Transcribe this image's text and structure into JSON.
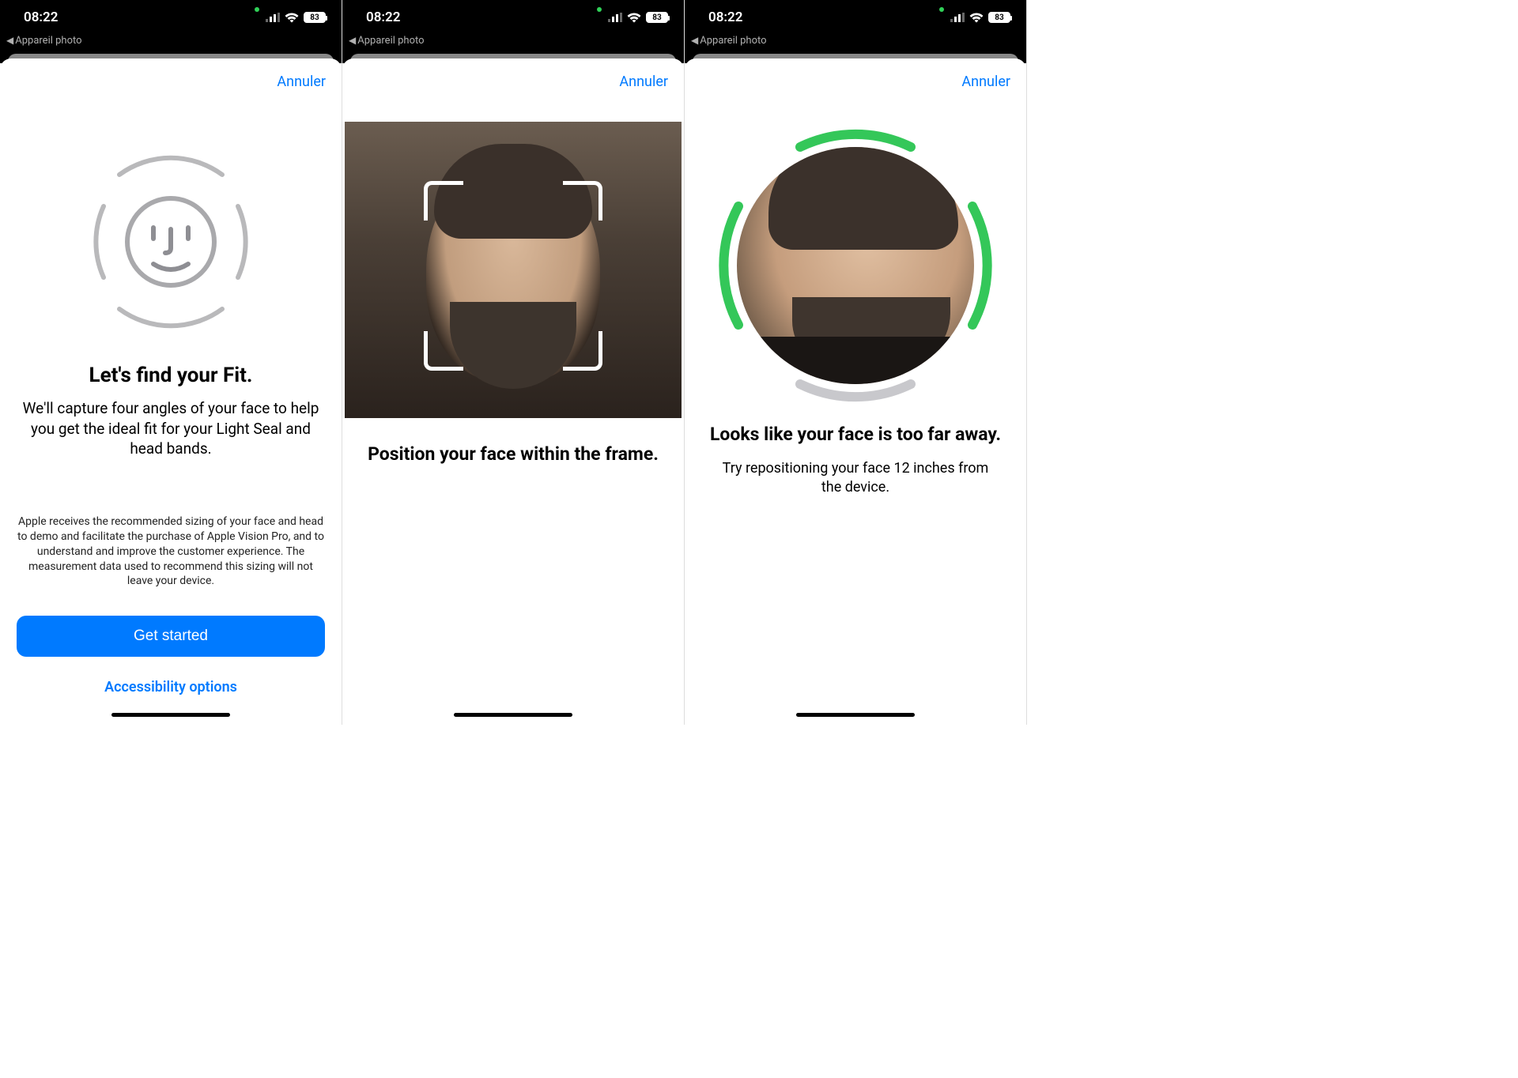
{
  "status": {
    "time": "08:22",
    "battery": "83",
    "breadcrumb_label": "Appareil photo"
  },
  "nav": {
    "cancel": "Annuler"
  },
  "screen1": {
    "title": "Let's find your Fit.",
    "subtitle": "We'll capture four angles of your face to help you get the ideal fit for your Light Seal and head bands.",
    "disclaimer": "Apple receives the recommended sizing of your face and head to demo and facilitate the purchase of Apple Vision Pro, and to understand and improve the customer experience. The measurement data used to recommend this sizing will not leave your device.",
    "primary_button": "Get started",
    "secondary_link": "Accessibility options"
  },
  "screen2": {
    "title": "Position your face within the frame."
  },
  "screen3": {
    "title": "Looks like your face is too far away.",
    "subtitle": "Try repositioning your face 12 inches from the device."
  }
}
